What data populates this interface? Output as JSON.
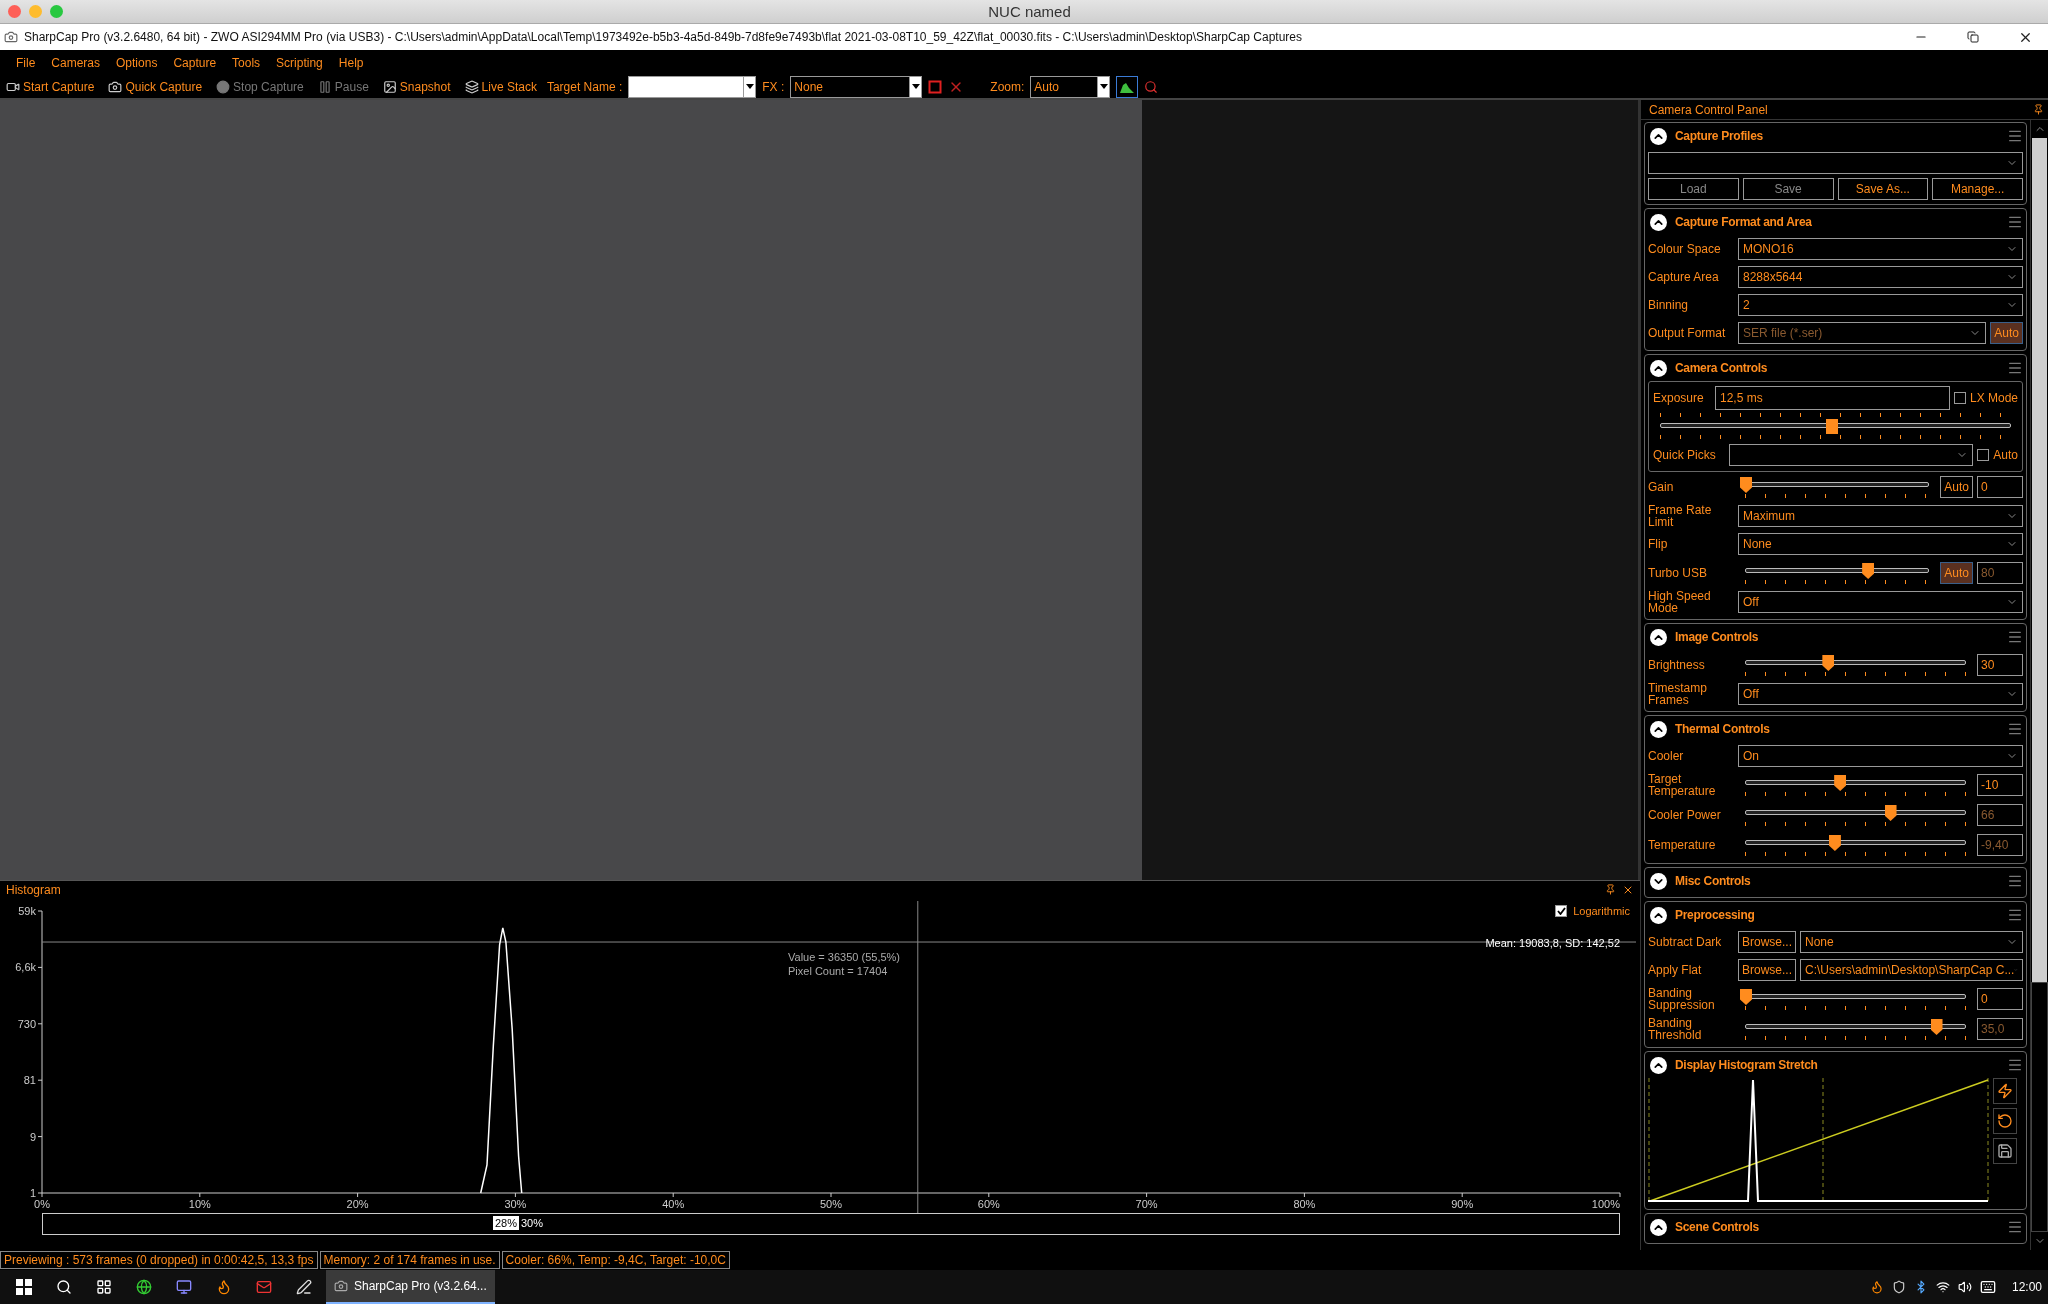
{
  "mac_window": {
    "title": "NUC named"
  },
  "window": {
    "title": "SharpCap Pro (v3.2.6480, 64 bit) - ZWO ASI294MM Pro (via USB3) - C:\\Users\\admin\\AppData\\Local\\Temp\\1973492e-b5b3-4a5d-849b-7d8fe9e7493b\\flat 2021-03-08T10_59_42Z\\flat_00030.fits - C:\\Users\\admin\\Desktop\\SharpCap Captures"
  },
  "menu": [
    "File",
    "Cameras",
    "Options",
    "Capture",
    "Tools",
    "Scripting",
    "Help"
  ],
  "toolbar": {
    "buttons": [
      {
        "label": "Start Capture",
        "disabled": false
      },
      {
        "label": "Quick Capture",
        "disabled": false
      },
      {
        "label": "Stop Capture",
        "disabled": true
      },
      {
        "label": "Pause",
        "disabled": true
      },
      {
        "label": "Snapshot",
        "disabled": false
      },
      {
        "label": "Live Stack",
        "disabled": false
      }
    ],
    "target_name": {
      "label": "Target Name :"
    },
    "fx": {
      "label": "FX :",
      "value": "None"
    },
    "zoom": {
      "label": "Zoom:",
      "value": "Auto"
    },
    "histogram_toggle": {
      "selected": true
    }
  },
  "camera_panel": {
    "title": "Camera Control Panel",
    "sections": [
      {
        "title": "Capture Profiles",
        "expanded": true,
        "rows": [
          {
            "kind": "profile",
            "buttons": [
              {
                "label": "Load",
                "disabled": true
              },
              {
                "label": "Save",
                "disabled": true
              },
              {
                "label": "Save As...",
                "disabled": false
              },
              {
                "label": "Manage...",
                "disabled": false
              }
            ]
          }
        ]
      },
      {
        "title": "Capture Format and Area",
        "expanded": true,
        "rows": [
          {
            "kind": "select",
            "label": "Colour Space",
            "value": "MONO16",
            "disabled": false
          },
          {
            "kind": "select",
            "label": "Capture Area",
            "value": "8288x5644",
            "disabled": false
          },
          {
            "kind": "select",
            "label": "Binning",
            "value": "2",
            "disabled": false
          },
          {
            "kind": "select",
            "label": "Output Format",
            "value": "SER file (*.ser)",
            "disabled": true,
            "auto": {
              "label": "Auto",
              "on": true
            }
          }
        ]
      },
      {
        "title": "Camera Controls",
        "expanded": true,
        "rows": [
          {
            "kind": "exposure",
            "label": "Exposure",
            "value": "12,5 ms",
            "level": 0.49,
            "option": {
              "label": "LX Mode",
              "checked": false
            },
            "quick_label": "Quick Picks",
            "quick_option": {
              "label": "Auto",
              "checked": false
            }
          },
          {
            "kind": "slider",
            "label": "Gain",
            "level": 0,
            "auto": {
              "label": "Auto",
              "on": false
            },
            "value": "0",
            "value_disabled": false
          },
          {
            "kind": "select",
            "label": "Frame Rate Limit",
            "value": "Maximum",
            "disabled": false
          },
          {
            "kind": "select",
            "label": "Flip",
            "value": "None",
            "disabled": false
          },
          {
            "kind": "slider",
            "label": "Turbo USB",
            "level": 0.67,
            "auto": {
              "label": "Auto",
              "on": true
            },
            "value": "80",
            "value_disabled": true
          },
          {
            "kind": "select",
            "label": "High Speed Mode",
            "value": "Off",
            "disabled": false
          }
        ]
      },
      {
        "title": "Image Controls",
        "expanded": true,
        "rows": [
          {
            "kind": "slider",
            "label": "Brightness",
            "level": 0.376,
            "value": "30",
            "value_disabled": false
          },
          {
            "kind": "select",
            "label": "Timestamp Frames",
            "value": "Off",
            "disabled": false
          }
        ]
      },
      {
        "title": "Thermal Controls",
        "expanded": true,
        "rows": [
          {
            "kind": "select",
            "label": "Cooler",
            "value": "On",
            "disabled": false
          },
          {
            "kind": "slider",
            "label": "Target Temperature",
            "level": 0.43,
            "value": "-10",
            "value_disabled": false
          },
          {
            "kind": "slider",
            "label": "Cooler Power",
            "level": 0.66,
            "value": "66",
            "value_disabled": true
          },
          {
            "kind": "slider",
            "label": "Temperature",
            "level": 0.406,
            "value": "-9,40",
            "value_disabled": true
          }
        ]
      },
      {
        "title": "Misc Controls",
        "expanded": false
      },
      {
        "title": "Preprocessing",
        "expanded": true,
        "rows": [
          {
            "kind": "browse",
            "label": "Subtract Dark",
            "button": "Browse...",
            "value": "None"
          },
          {
            "kind": "browse",
            "label": "Apply Flat",
            "button": "Browse...",
            "value": "C:\\Users\\admin\\Desktop\\SharpCap C..."
          },
          {
            "kind": "slider",
            "label": "Banding Suppression",
            "level": 0,
            "value": "0",
            "value_disabled": false
          },
          {
            "kind": "slider",
            "label": "Banding Threshold",
            "level": 0.87,
            "value": "35,0",
            "value_disabled": true
          }
        ]
      },
      {
        "title": "Display Histogram Stretch",
        "expanded": true,
        "rows": [
          {
            "kind": "stretch"
          }
        ]
      },
      {
        "title": "Scene Controls",
        "expanded": true
      }
    ]
  },
  "histogram": {
    "title": "Histogram",
    "logarithmic": {
      "label": "Logarithmic",
      "checked": true
    },
    "cursor_value": "Value = 36350 (55,5%)",
    "cursor_count": "Pixel Count = 17404",
    "stats": "Mean: 19083,8, SD: 142,52",
    "range": {
      "low": "28%",
      "high": "30%"
    },
    "y_axis_labels": [
      "59k",
      "6,6k",
      "730",
      "81",
      "9",
      "1"
    ],
    "x_axis_labels": [
      "0%",
      "10%",
      "20%",
      "30%",
      "40%",
      "50%",
      "60%",
      "70%",
      "80%",
      "90%",
      "100%"
    ]
  },
  "status_bar": [
    "Previewing : 573 frames (0 dropped) in 0:00:42,5, 13,3 fps",
    "Memory: 2 of 174 frames in use.",
    "Cooler: 66%, Temp: -9,4C, Target: -10,0C"
  ],
  "taskbar": {
    "apps": [
      {
        "label": "SharpCap Pro (v3.2.64...",
        "selected": true
      }
    ],
    "clock": "12:00"
  }
}
